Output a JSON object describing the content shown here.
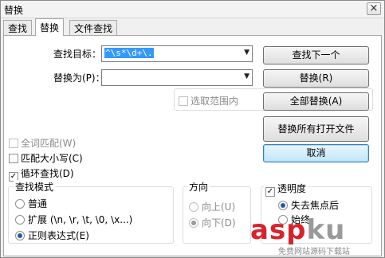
{
  "window": {
    "title": "替换",
    "close_glyph": "×"
  },
  "tabs": [
    {
      "label": "查找",
      "active": false
    },
    {
      "label": "替换",
      "active": true
    },
    {
      "label": "文件查找",
      "active": false
    }
  ],
  "find": {
    "label": "查找目标：",
    "value": "^\\s*\\d+\\."
  },
  "replace": {
    "label": "替换为(P)：",
    "value": ""
  },
  "buttons": {
    "find_next": "查找下一个",
    "replace": "替换(R)",
    "replace_all": "全部替换(A)",
    "replace_all_open": "替换所有打开文件",
    "cancel": "取消"
  },
  "in_selection": {
    "label": "选取范围内",
    "checked": false,
    "enabled": false
  },
  "options": {
    "whole_word": {
      "label": "全词匹配(W)",
      "checked": false,
      "enabled": false
    },
    "match_case": {
      "label": "匹配大小写(C)",
      "checked": false
    },
    "wrap": {
      "label": "循环查找(D)",
      "checked": true
    }
  },
  "search_mode": {
    "title": "查找模式",
    "items": [
      {
        "label": "普通",
        "selected": false
      },
      {
        "label": "扩展 (\\n, \\r, \\t, \\0, \\x...)",
        "selected": false
      },
      {
        "label": "正则表达式(E)",
        "selected": true
      }
    ]
  },
  "direction": {
    "title": "方向",
    "up": {
      "label": "向上(U)",
      "selected": false
    },
    "down": {
      "label": "向下(D)",
      "selected": true
    }
  },
  "transparency": {
    "label": "透明度",
    "checked": true,
    "lose_focus": "失去焦点后",
    "always": "始终"
  },
  "watermark": {
    "brand_a": "asp",
    "brand_b": "ku",
    "tagline": "免费网站源码下载站"
  },
  "colors": {
    "selection": "#3399ff",
    "radio_on": "#1d5fa8",
    "watermark": "#d8232a"
  }
}
